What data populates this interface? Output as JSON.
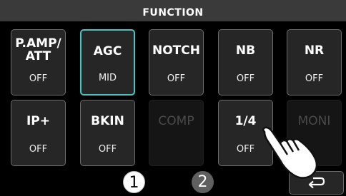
{
  "header": {
    "title": "FUNCTION"
  },
  "buttons": [
    {
      "label_line1": "P.AMP/",
      "label_line2": "ATT",
      "status": "OFF"
    },
    {
      "label": "AGC",
      "status": "MID"
    },
    {
      "label": "NOTCH",
      "status": "OFF"
    },
    {
      "label": "NB",
      "status": "OFF"
    },
    {
      "label": "NR",
      "status": "OFF"
    },
    {
      "label": "IP+",
      "status": "OFF"
    },
    {
      "label": "BKIN",
      "status": "OFF"
    },
    {
      "label": "COMP",
      "status": ""
    },
    {
      "label": "1/4",
      "status": "OFF"
    },
    {
      "label": "MONI",
      "status": ""
    }
  ],
  "callouts": {
    "first": "1",
    "second": "2"
  },
  "icons": {
    "return": "return-arrow-icon",
    "pointer": "pointing-hand-icon"
  },
  "colors": {
    "selected_border": "#48c7c2",
    "header_bg": "#3a3a3a"
  }
}
